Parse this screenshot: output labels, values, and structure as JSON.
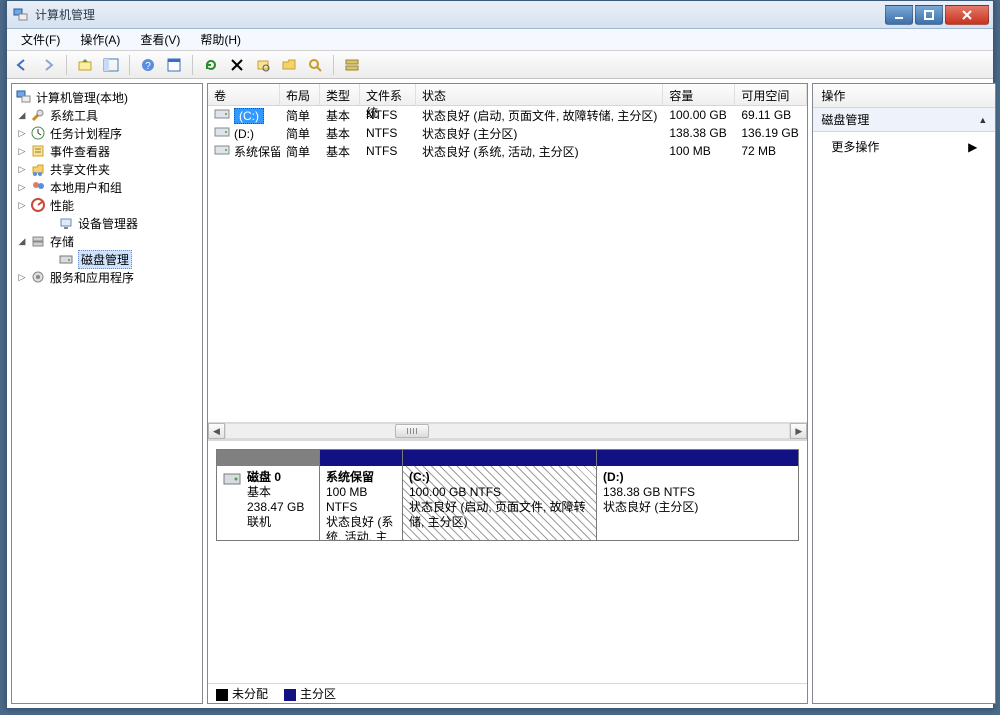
{
  "title": "计算机管理",
  "menu": {
    "file": "文件(F)",
    "action": "操作(A)",
    "view": "查看(V)",
    "help": "帮助(H)"
  },
  "tree": {
    "root": "计算机管理(本地)",
    "system_tools": "系统工具",
    "task_scheduler": "任务计划程序",
    "event_viewer": "事件查看器",
    "shared_folders": "共享文件夹",
    "users_groups": "本地用户和组",
    "performance": "性能",
    "device_manager": "设备管理器",
    "storage": "存储",
    "disk_mgmt": "磁盘管理",
    "services_apps": "服务和应用程序"
  },
  "vol_headers": {
    "volume": "卷",
    "layout": "布局",
    "type": "类型",
    "fs": "文件系统",
    "status": "状态",
    "capacity": "容量",
    "free": "可用空间"
  },
  "volumes": [
    {
      "name": "(C:)",
      "layout": "简单",
      "type": "基本",
      "fs": "NTFS",
      "status": "状态良好 (启动, 页面文件, 故障转储, 主分区)",
      "capacity": "100.00 GB",
      "free": "69.11 GB",
      "selected": true
    },
    {
      "name": "(D:)",
      "layout": "简单",
      "type": "基本",
      "fs": "NTFS",
      "status": "状态良好 (主分区)",
      "capacity": "138.38 GB",
      "free": "136.19 GB",
      "selected": false
    },
    {
      "name": "系统保留",
      "layout": "简单",
      "type": "基本",
      "fs": "NTFS",
      "status": "状态良好 (系统, 活动, 主分区)",
      "capacity": "100 MB",
      "free": "72 MB",
      "selected": false
    }
  ],
  "disk": {
    "label": "磁盘 0",
    "type": "基本",
    "size": "238.47 GB",
    "status": "联机",
    "parts": [
      {
        "title": "系统保留",
        "line2": "100 MB NTFS",
        "line3": "状态良好 (系统, 活动, 主分区)",
        "hatched": false,
        "flex": "0 0 82px"
      },
      {
        "title": "(C:)",
        "line2": "100.00 GB NTFS",
        "line3": "状态良好 (启动, 页面文件, 故障转储, 主分区)",
        "hatched": true,
        "flex": "0 0 194px"
      },
      {
        "title": "(D:)",
        "line2": "138.38 GB NTFS",
        "line3": "状态良好 (主分区)",
        "hatched": false,
        "flex": "1 1 0"
      }
    ]
  },
  "legend": {
    "unalloc": "未分配",
    "primary": "主分区"
  },
  "right": {
    "header": "操作",
    "section": "磁盘管理",
    "more": "更多操作"
  }
}
